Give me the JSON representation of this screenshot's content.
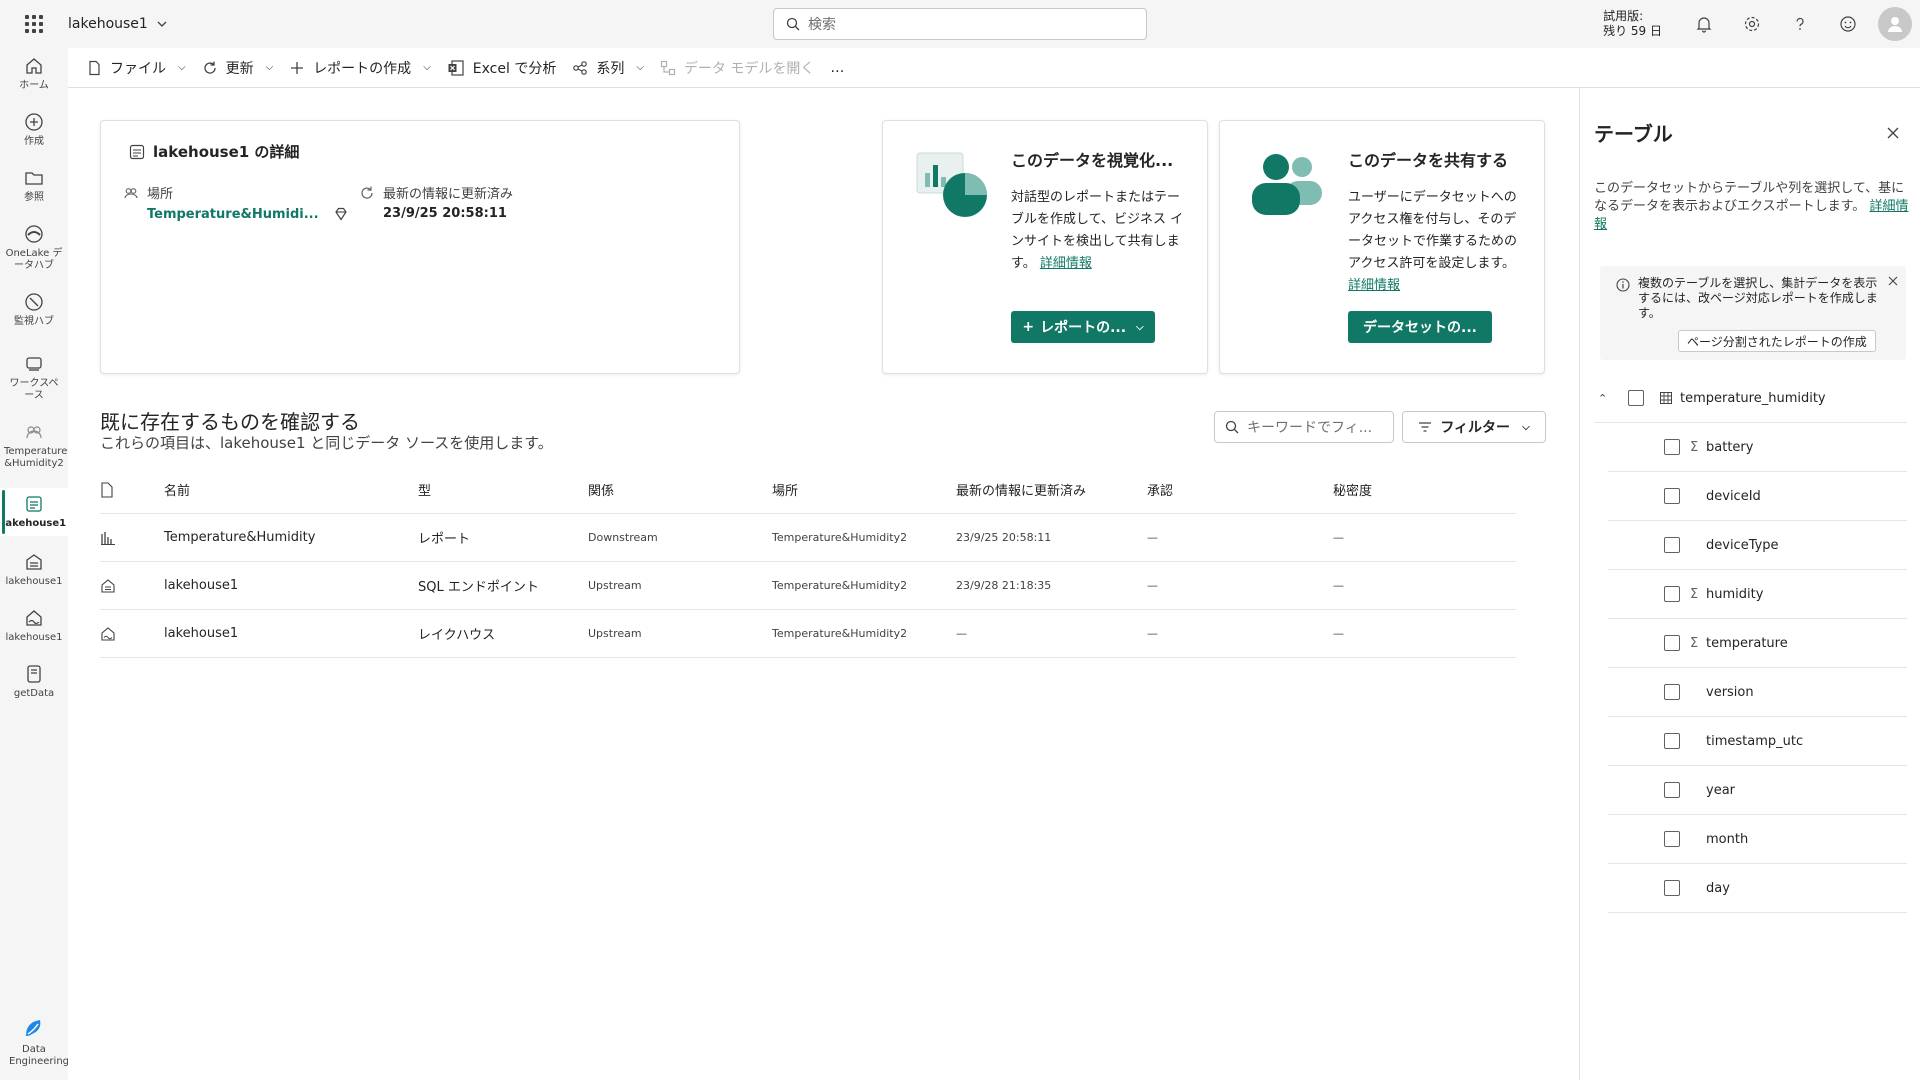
{
  "app": {
    "workspace_name": "lakehouse1",
    "search_placeholder": "検索",
    "trial_line1": "試用版:",
    "trial_line2": "残り 59 日"
  },
  "nav": [
    {
      "label": "ホーム",
      "icon": "home-icon"
    },
    {
      "label": "作成",
      "icon": "create-icon"
    },
    {
      "label": "参照",
      "icon": "browse-icon"
    },
    {
      "label": "OneLake データハブ",
      "icon": "onelake-icon"
    },
    {
      "label": "監視ハブ",
      "icon": "monitor-icon"
    },
    {
      "label": "ワークスペース",
      "icon": "workspaces-icon"
    },
    {
      "label": "Temperature &Humidity2",
      "icon": "workspace-icon"
    },
    {
      "label": "lakehouse1",
      "icon": "semantic-model-icon"
    },
    {
      "label": "lakehouse1",
      "icon": "sql-endpoint-icon"
    },
    {
      "label": "lakehouse1",
      "icon": "lakehouse-icon"
    },
    {
      "label": "getData",
      "icon": "notebook-icon"
    },
    {
      "label": "Data Engineering",
      "icon": "data-engineering-icon"
    }
  ],
  "toolbar": {
    "file": "ファイル",
    "refresh": "更新",
    "create_report": "レポートの作成",
    "analyze_excel": "Excel で分析",
    "lineage": "系列",
    "open_model": "データ モデルを開く",
    "more": "…"
  },
  "details": {
    "title": "lakehouse1 の詳細",
    "location_label": "場所",
    "location_value": "Temperature&Humidi...",
    "refreshed_label": "最新の情報に更新済み",
    "refreshed_value": "23/9/25 20:58:11"
  },
  "visualize": {
    "title": "このデータを視覚化...",
    "text": "対話型のレポートまたはテーブルを作成して、ビジネス インサイトを検出して共有します。",
    "link": "詳細情報",
    "button": "レポートの..."
  },
  "share": {
    "title": "このデータを共有する",
    "text": "ユーザーにデータセットへのアクセス権を付与し、そのデータセットで作業するためのアクセス許可を設定します。",
    "link": "詳細情報",
    "button": "データセットの..."
  },
  "related": {
    "title": "既に存在するものを確認する",
    "subtitle": "これらの項目は、lakehouse1 と同じデータ ソースを使用します。",
    "filter_placeholder": "キーワードでフィ...",
    "filter_button": "フィルター",
    "columns": [
      "名前",
      "型",
      "関係",
      "場所",
      "最新の情報に更新済み",
      "承認",
      "秘密度"
    ],
    "rows": [
      {
        "icon": "report-icon",
        "name": "Temperature&Humidity",
        "type": "レポート",
        "relation": "Downstream",
        "location": "Temperature&Humidity2",
        "refreshed": "23/9/25 20:58:11",
        "endorsement": "—",
        "sensitivity": "—"
      },
      {
        "icon": "sql-endpoint-icon",
        "name": "lakehouse1",
        "type": "SQL エンドポイント",
        "relation": "Upstream",
        "location": "Temperature&Humidity2",
        "refreshed": "23/9/28 21:18:35",
        "endorsement": "—",
        "sensitivity": "—"
      },
      {
        "icon": "lakehouse-icon",
        "name": "lakehouse1",
        "type": "レイクハウス",
        "relation": "Upstream",
        "location": "Temperature&Humidity2",
        "refreshed": "—",
        "endorsement": "—",
        "sensitivity": "—"
      }
    ]
  },
  "tables_panel": {
    "title": "テーブル",
    "desc": "このデータセットからテーブルや列を選択して、基になるデータを表示およびエクスポートします。",
    "link": "詳細情報",
    "info": "複数のテーブルを選択し、集計データを表示するには、改ページ対応レポートを作成します。",
    "info_button": "ページ分割されたレポートの作成",
    "table_name": "temperature_humidity",
    "columns": [
      {
        "name": "battery",
        "sigma": "Σ"
      },
      {
        "name": "deviceId",
        "sigma": ""
      },
      {
        "name": "deviceType",
        "sigma": ""
      },
      {
        "name": "humidity",
        "sigma": "Σ"
      },
      {
        "name": "temperature",
        "sigma": "Σ"
      },
      {
        "name": "version",
        "sigma": ""
      },
      {
        "name": "timestamp_utc",
        "sigma": ""
      },
      {
        "name": "year",
        "sigma": ""
      },
      {
        "name": "month",
        "sigma": ""
      },
      {
        "name": "day",
        "sigma": ""
      }
    ]
  },
  "colors": {
    "accent": "#117865"
  }
}
